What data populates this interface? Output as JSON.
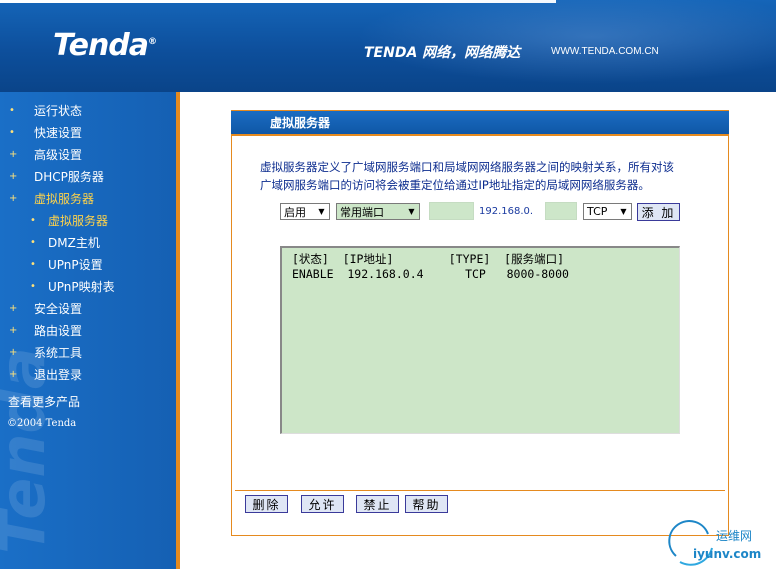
{
  "header": {
    "logo": "Tenda",
    "logo_mark": "®",
    "slogan": "TENDA 网络，网络腾达",
    "url": "WWW.TENDA.COM.CN"
  },
  "sidebar": {
    "items": [
      {
        "label": "运行状态"
      },
      {
        "label": "快速设置"
      },
      {
        "label": "高级设置"
      },
      {
        "label": "DHCP服务器"
      },
      {
        "label": "虚拟服务器",
        "active": true
      },
      {
        "label": "虚拟服务器",
        "sub": true,
        "active": true
      },
      {
        "label": "DMZ主机",
        "sub": true
      },
      {
        "label": "UPnP设置",
        "sub": true
      },
      {
        "label": "UPnP映射表",
        "sub": true
      },
      {
        "label": "安全设置"
      },
      {
        "label": "路由设置"
      },
      {
        "label": "系统工具"
      },
      {
        "label": "退出登录"
      }
    ],
    "more": "查看更多产品",
    "copyright": "©2004 Tenda",
    "watermark": "Tenda"
  },
  "panel": {
    "title": "虚拟服务器",
    "description_line1": "虚拟服务器定义了广域网服务端口和局域网网络服务器之间的映射关系，所有对该",
    "description_line2": "广域网服务端口的访问将会被重定位给通过IP地址指定的局域网网络服务器。",
    "form": {
      "enable_select": "启用",
      "port_select": "常用端口",
      "ip_prefix": "192.168.0.",
      "protocol_select": "TCP",
      "add_button": "添 加"
    },
    "ghost_text": "虚拟服务器",
    "list_header": "[状态]  [IP地址]        [TYPE]  [服务端口]",
    "list_rows": [
      "ENABLE  192.168.0.4      TCP   8000-8000"
    ],
    "buttons": {
      "delete": "删除",
      "allow": "允许",
      "forbid": "禁止",
      "help": "帮助"
    }
  },
  "watermark_site": {
    "cn": "运维网",
    "en": "iyunv.com"
  }
}
